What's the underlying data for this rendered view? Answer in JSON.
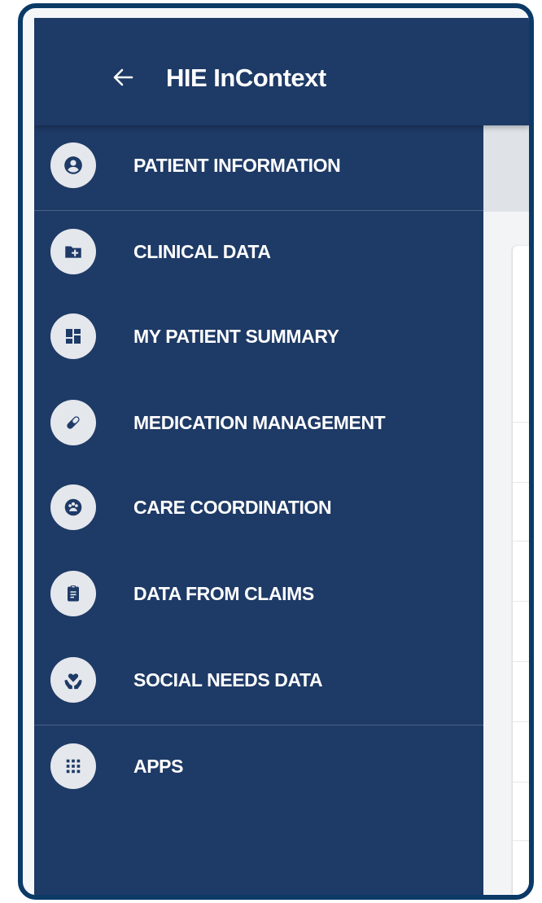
{
  "header": {
    "title": "HIE InContext",
    "back_icon": "arrow-left-icon"
  },
  "sidebar": {
    "items": [
      {
        "label": "PATIENT INFORMATION",
        "icon": "account-circle-icon"
      },
      {
        "label": "CLINICAL DATA",
        "icon": "folder-plus-icon"
      },
      {
        "label": "MY PATIENT SUMMARY",
        "icon": "dashboard-icon"
      },
      {
        "label": "MEDICATION MANAGEMENT",
        "icon": "pill-icon"
      },
      {
        "label": "CARE COORDINATION",
        "icon": "group-circle-icon"
      },
      {
        "label": "DATA FROM CLAIMS",
        "icon": "clipboard-icon"
      },
      {
        "label": "SOCIAL NEEDS DATA",
        "icon": "hand-heart-icon"
      },
      {
        "label": "APPS",
        "icon": "apps-grid-icon"
      }
    ]
  },
  "colors": {
    "sidebar_bg": "#1e3a66",
    "frame_border": "#0b3a67",
    "icon_circle": "#e4e7ec",
    "icon_fg": "#1e3a66"
  }
}
